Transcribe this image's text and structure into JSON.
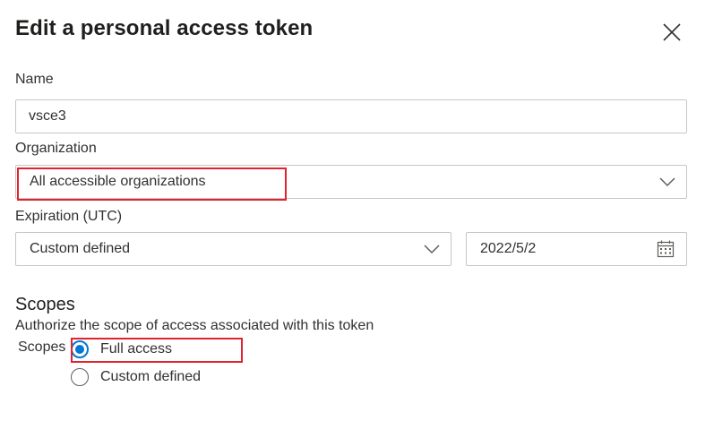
{
  "dialog": {
    "title": "Edit a personal access token",
    "close_icon": "close-icon"
  },
  "name_field": {
    "label": "Name",
    "value": "vsce3"
  },
  "organization_field": {
    "label": "Organization",
    "selected": "All accessible organizations",
    "icon": "chevron-down-icon"
  },
  "expiration_field": {
    "label": "Expiration (UTC)",
    "selected": "Custom defined",
    "date_value": "2022/5/2",
    "dropdown_icon": "chevron-down-icon",
    "date_icon": "calendar-icon"
  },
  "scopes": {
    "heading": "Scopes",
    "description": "Authorize the scope of access associated with this token",
    "group_label": "Scopes",
    "options": [
      {
        "label": "Full access",
        "selected": true
      },
      {
        "label": "Custom defined",
        "selected": false
      }
    ]
  },
  "colors": {
    "accent": "#0078d4",
    "highlight": "#e0232e",
    "border": "#c8c6c4"
  }
}
